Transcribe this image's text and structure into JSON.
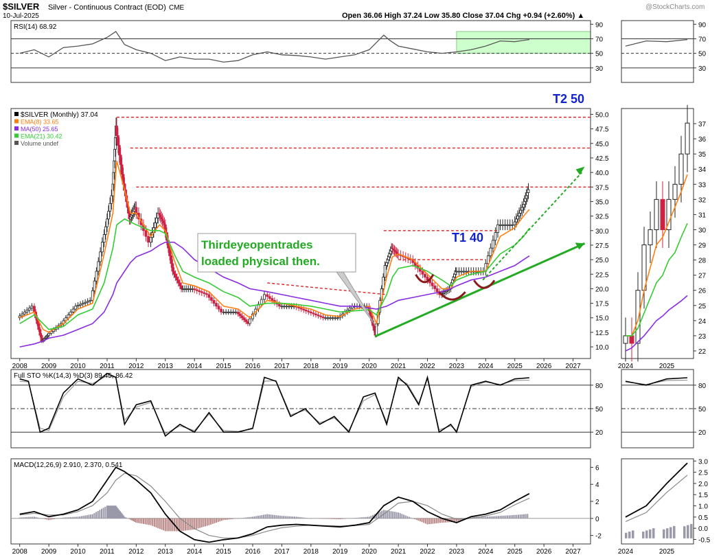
{
  "header": {
    "symbol": "$SILVER",
    "name": "Silver - Continuous Contract (EOD)",
    "exchange": "CME",
    "date": "10-Jul-2025",
    "watermark": "@StockCharts.com",
    "ohlc": "Open 36.06  High 37.24  Low 35.80  Close 37.04  Chg +0.94 (+2.60%) ▲"
  },
  "colors": {
    "price_up": "#222222",
    "price_down": "#cc2244",
    "ema8": "#ff7f0e",
    "ma50": "#8a2be2",
    "ema21": "#33cc33",
    "annotation_green": "#22aa22",
    "annotation_red": "#dd2222",
    "annotation_blue": "#1122cc",
    "rsi_zone": "#ccffcc",
    "macd_hist": "#aaaaaa"
  },
  "chart_data": [
    {
      "type": "line",
      "panel": "rsi",
      "label": "RSI(14) 68.92",
      "ylim": [
        10,
        95
      ],
      "yticks": [
        30,
        50,
        70,
        90
      ],
      "x": [
        2008.0,
        2008.5,
        2009.0,
        2009.5,
        2010.0,
        2010.5,
        2011.0,
        2011.3,
        2011.6,
        2012.0,
        2012.5,
        2013.0,
        2013.5,
        2014.0,
        2014.5,
        2015.0,
        2015.5,
        2016.0,
        2016.5,
        2017.0,
        2017.5,
        2018.0,
        2018.5,
        2019.0,
        2019.5,
        2020.0,
        2020.5,
        2020.7,
        2021.0,
        2021.5,
        2022.0,
        2022.5,
        2023.0,
        2023.5,
        2024.0,
        2024.5,
        2025.0,
        2025.5
      ],
      "values": [
        50,
        55,
        45,
        58,
        60,
        63,
        72,
        80,
        62,
        55,
        50,
        40,
        45,
        42,
        42,
        38,
        40,
        48,
        52,
        48,
        47,
        45,
        42,
        45,
        48,
        55,
        75,
        68,
        60,
        56,
        52,
        50,
        52,
        55,
        60,
        67,
        66,
        68.92
      ]
    },
    {
      "type": "line",
      "panel": "price",
      "label": "$SILVER (Monthly) 37.04",
      "ylim": [
        8,
        51
      ],
      "yticks": [
        10.0,
        12.5,
        15.0,
        17.5,
        20.0,
        22.5,
        25.0,
        27.5,
        30.0,
        32.5,
        35.0,
        37.5,
        40.0,
        42.5,
        45.0,
        47.5,
        50.0
      ],
      "xticks": [
        2008,
        2009,
        2010,
        2011,
        2012,
        2013,
        2014,
        2015,
        2016,
        2017,
        2018,
        2019,
        2020,
        2021,
        2022,
        2023,
        2024,
        2025,
        2026,
        2027
      ],
      "x": [
        2008.0,
        2008.5,
        2008.8,
        2009.0,
        2009.5,
        2010.0,
        2010.5,
        2010.9,
        2011.2,
        2011.33,
        2011.6,
        2011.8,
        2012.0,
        2012.5,
        2012.8,
        2013.0,
        2013.3,
        2013.6,
        2014.0,
        2014.5,
        2015.0,
        2015.5,
        2015.9,
        2016.5,
        2017.0,
        2017.5,
        2018.0,
        2018.5,
        2019.0,
        2019.5,
        2020.0,
        2020.25,
        2020.6,
        2020.8,
        2021.0,
        2021.5,
        2022.0,
        2022.5,
        2022.8,
        2023.0,
        2023.5,
        2024.0,
        2024.5,
        2025.0,
        2025.3,
        2025.5
      ],
      "series": [
        {
          "name": "$SILVER (Monthly) 37.04",
          "values": [
            15,
            17,
            11,
            12,
            14,
            17,
            18,
            28,
            36,
            48,
            38,
            32,
            34,
            28,
            33,
            31,
            23,
            20,
            20,
            19,
            16,
            16,
            14,
            19,
            17,
            17,
            16,
            15,
            15,
            17,
            17,
            12,
            24,
            27,
            26,
            25,
            22,
            19,
            20,
            23,
            23,
            23,
            31,
            31,
            34,
            37.04
          ]
        },
        {
          "name": "EMA(8) 33.65",
          "values": [
            15,
            16,
            13,
            12.5,
            14,
            16.5,
            17.5,
            26,
            33,
            42,
            37,
            33,
            33,
            29,
            31,
            30,
            25,
            21,
            20.5,
            19.5,
            17,
            16.5,
            15,
            18,
            17.5,
            17,
            16.5,
            15.5,
            15.2,
            16.5,
            17,
            14,
            22,
            25.5,
            26,
            25,
            22.5,
            20,
            20,
            22,
            23,
            23,
            29,
            30.5,
            32.5,
            33.65
          ]
        },
        {
          "name": "MA(50) 25.65",
          "values": [
            10,
            10.5,
            11,
            11.5,
            12,
            13,
            14,
            16,
            19,
            21,
            23,
            24.5,
            25.5,
            26.5,
            27.5,
            28,
            28,
            27,
            25,
            23.5,
            22,
            21,
            20,
            19.5,
            19,
            18.5,
            18,
            17.5,
            17,
            17,
            16.7,
            16.5,
            17,
            17.5,
            18,
            18.5,
            19,
            19.5,
            20,
            20.5,
            21.5,
            22,
            23,
            24,
            25,
            25.65
          ]
        },
        {
          "name": "EMA(21) 30.42",
          "values": [
            14,
            15.5,
            14,
            13,
            13.5,
            15.5,
            16.5,
            21,
            27,
            31,
            32,
            31.5,
            31,
            30,
            30,
            29.5,
            26,
            23,
            22,
            21,
            19.5,
            18.5,
            17,
            17.5,
            17.5,
            17.3,
            17,
            16.5,
            16,
            16.2,
            16.4,
            15.5,
            19,
            22,
            23.5,
            24,
            23,
            21.5,
            20.5,
            21.5,
            22.5,
            23,
            26,
            27.5,
            29,
            30.42
          ]
        }
      ],
      "legend": [
        "$SILVER (Monthly) 37.04",
        "EMA(8) 33.65",
        "MA(50) 25.65",
        "EMA(21) 30.42",
        "Volume undef"
      ]
    },
    {
      "type": "line",
      "panel": "full_sto",
      "label": "Full STO %K(14,3) %D(3) 89.45, 86.42",
      "ylim": [
        0,
        100
      ],
      "yticks": [
        20,
        50,
        80
      ],
      "x": [
        2008.0,
        2008.3,
        2008.7,
        2009.0,
        2009.5,
        2010.0,
        2010.5,
        2011.0,
        2011.3,
        2011.6,
        2012.0,
        2012.5,
        2013.0,
        2013.5,
        2014.0,
        2014.5,
        2015.0,
        2015.5,
        2016.0,
        2016.4,
        2016.8,
        2017.3,
        2017.8,
        2018.3,
        2018.8,
        2019.3,
        2019.8,
        2020.2,
        2020.6,
        2021.0,
        2021.3,
        2021.7,
        2022.0,
        2022.4,
        2022.8,
        2023.0,
        2023.5,
        2024.0,
        2024.5,
        2025.0,
        2025.5
      ],
      "series": [
        {
          "name": "%K",
          "values": [
            88,
            85,
            20,
            25,
            70,
            88,
            80,
            95,
            90,
            30,
            55,
            60,
            15,
            30,
            20,
            45,
            20,
            20,
            25,
            90,
            85,
            40,
            50,
            30,
            40,
            20,
            65,
            70,
            30,
            90,
            80,
            55,
            90,
            20,
            30,
            20,
            80,
            85,
            80,
            88,
            89.45
          ]
        },
        {
          "name": "%D",
          "values": [
            85,
            84,
            25,
            22,
            65,
            85,
            82,
            92,
            90,
            35,
            52,
            58,
            18,
            28,
            22,
            43,
            22,
            21,
            24,
            85,
            86,
            42,
            48,
            32,
            38,
            22,
            60,
            68,
            33,
            87,
            82,
            57,
            88,
            23,
            28,
            22,
            78,
            84,
            81,
            86,
            86.42
          ]
        }
      ]
    },
    {
      "type": "line",
      "panel": "macd",
      "label": "MACD(12,26,9) 2.910, 2.370, 0.541",
      "ylim": [
        -3,
        7
      ],
      "yticks": [
        -2,
        0,
        2,
        4,
        6
      ],
      "x": [
        2008.0,
        2008.5,
        2009.0,
        2009.5,
        2010.0,
        2010.5,
        2011.0,
        2011.3,
        2011.6,
        2012.0,
        2012.5,
        2013.0,
        2013.5,
        2014.0,
        2014.5,
        2015.0,
        2015.5,
        2016.0,
        2016.5,
        2017.0,
        2017.5,
        2018.0,
        2018.5,
        2019.0,
        2019.5,
        2020.0,
        2020.5,
        2021.0,
        2021.5,
        2022.0,
        2022.5,
        2023.0,
        2023.5,
        2024.0,
        2024.5,
        2025.0,
        2025.5
      ],
      "series": [
        {
          "name": "MACD",
          "values": [
            0.5,
            0.8,
            0.2,
            0.5,
            1.0,
            2.0,
            4.5,
            6.0,
            5.5,
            4.5,
            3.0,
            0.5,
            -1.5,
            -2.5,
            -2.8,
            -2.5,
            -2.3,
            -1.8,
            -1.0,
            -0.8,
            -0.7,
            -0.8,
            -0.9,
            -1.0,
            -0.8,
            -0.5,
            1.5,
            2.5,
            2.0,
            0.8,
            0.0,
            -0.5,
            0.2,
            0.5,
            1.0,
            2.0,
            2.91
          ]
        },
        {
          "name": "Signal",
          "values": [
            0.4,
            0.6,
            0.4,
            0.4,
            0.8,
            1.5,
            3.0,
            4.5,
            5.3,
            5.0,
            3.8,
            2.0,
            0.0,
            -1.2,
            -2.0,
            -2.3,
            -2.3,
            -2.0,
            -1.5,
            -1.1,
            -0.9,
            -0.8,
            -0.85,
            -0.9,
            -0.85,
            -0.7,
            0.5,
            1.8,
            2.0,
            1.5,
            0.5,
            -0.1,
            0.0,
            0.3,
            0.7,
            1.6,
            2.37
          ]
        },
        {
          "name": "Histogram",
          "values": [
            0.1,
            0.2,
            -0.2,
            0.1,
            0.2,
            0.5,
            1.5,
            1.5,
            0.2,
            -0.5,
            -0.8,
            -1.5,
            -1.5,
            -1.3,
            -0.8,
            -0.2,
            0.0,
            0.2,
            0.5,
            0.3,
            0.2,
            0.0,
            -0.05,
            -0.1,
            0.05,
            0.2,
            1.0,
            0.7,
            0.0,
            -0.7,
            -0.5,
            -0.4,
            0.2,
            0.2,
            0.3,
            0.4,
            0.541
          ]
        }
      ]
    },
    {
      "type": "line",
      "panel": "zoom_price",
      "ylim": [
        21.5,
        38
      ],
      "yticks": [
        22,
        23,
        24,
        25,
        26,
        27,
        28,
        29,
        30,
        31,
        32,
        33,
        34,
        35,
        36,
        37
      ],
      "xticks": [
        2024,
        2025
      ],
      "x": [
        2024.0,
        2024.15,
        2024.3,
        2024.45,
        2024.6,
        2024.75,
        2024.9,
        2025.05,
        2025.2,
        2025.35,
        2025.5
      ],
      "series": [
        {
          "name": "$SILVER (Monthly) 37.04",
          "values": [
            23,
            22.5,
            26,
            29,
            30,
            32,
            30,
            32,
            33,
            35,
            37.04
          ]
        },
        {
          "name": "EMA(8) 33.65",
          "values": [
            23,
            23,
            24,
            26,
            27.5,
            29,
            29.5,
            30.5,
            31.5,
            32.5,
            33.65
          ]
        },
        {
          "name": "MA(50) 25.65",
          "values": [
            22,
            22.2,
            22.6,
            23,
            23.5,
            24,
            24.3,
            24.7,
            25,
            25.3,
            25.65
          ]
        },
        {
          "name": "EMA(21) 30.42",
          "values": [
            23,
            23,
            23.5,
            24.5,
            25.5,
            26.5,
            27,
            28,
            28.5,
            29.5,
            30.42
          ]
        }
      ]
    }
  ],
  "annotations": {
    "callout": "Thirdeyeopentrades\nloaded physical then.",
    "t1": "T1 40",
    "t2": "T2 50"
  },
  "zoom_panels": {
    "rsi_yticks": [
      30,
      50,
      70,
      90
    ],
    "sto_yticks": [
      20,
      50,
      80
    ],
    "macd_yticks": [
      -0.5,
      0.0,
      0.5,
      1.0,
      1.5,
      2.0,
      2.5,
      3.0
    ],
    "xticks": [
      2024,
      2025
    ]
  }
}
